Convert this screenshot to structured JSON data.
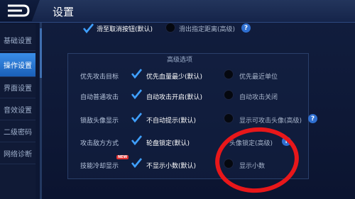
{
  "header": {
    "title": "设置"
  },
  "sidebar": {
    "items": [
      {
        "label": "基础设置",
        "active": false
      },
      {
        "label": "操作设置",
        "active": true
      },
      {
        "label": "界面设置",
        "active": false
      },
      {
        "label": "音效设置",
        "active": false
      },
      {
        "label": "二级密码",
        "active": false
      },
      {
        "label": "网络诊断",
        "active": false
      }
    ]
  },
  "top_row": {
    "option1": "滑至取消按钮(默认)",
    "option2": "滑出指定距离(高级)"
  },
  "advanced": {
    "title": "高级选项",
    "rows": [
      {
        "label": "优先攻击目标",
        "option1": "优先血量最少(默认)",
        "option2": "优先最近单位"
      },
      {
        "label": "自动普通攻击",
        "option1": "自动攻击开启(默认)",
        "option2": "自动攻击关闭"
      },
      {
        "label": "锁敌头像显示",
        "option1": "不自动提示(默认)",
        "option2": "显示可攻击头像(高级)"
      },
      {
        "label": "攻击敌方方式",
        "option1": "轮盘锁定(默认)",
        "option2": "头像锁定(高级)"
      },
      {
        "label": "技能冷却显示",
        "option1": "不显示小数(默认)",
        "option2": "显示小数"
      }
    ],
    "new_badge": "NEW"
  },
  "colors": {
    "accent": "#2f6fd0",
    "check": "#3fa0ff",
    "annotation": "#e8171a"
  },
  "icons": {
    "back": "back-arrow-icon",
    "check": "check-icon",
    "help": "question-icon"
  }
}
